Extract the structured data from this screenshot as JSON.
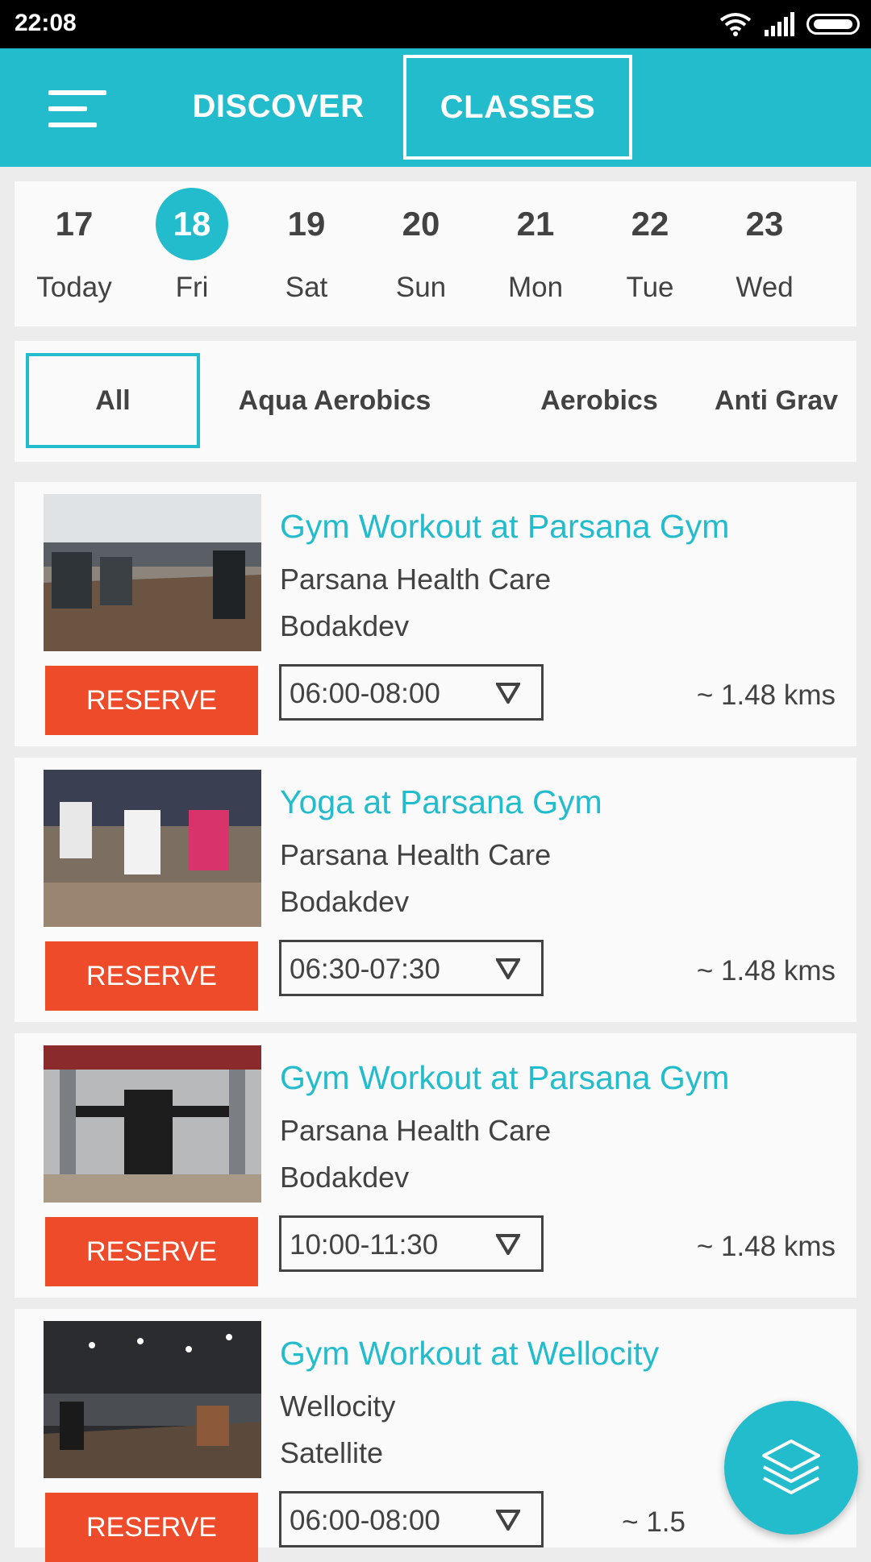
{
  "status_bar": {
    "time": "22:08"
  },
  "app_bar": {
    "tabs": [
      {
        "label": "DISCOVER",
        "selected": false
      },
      {
        "label": "CLASSES",
        "selected": true
      }
    ]
  },
  "dates": [
    {
      "num": "17",
      "label": "Today",
      "selected": false
    },
    {
      "num": "18",
      "label": "Fri",
      "selected": true
    },
    {
      "num": "19",
      "label": "Sat",
      "selected": false
    },
    {
      "num": "20",
      "label": "Sun",
      "selected": false
    },
    {
      "num": "21",
      "label": "Mon",
      "selected": false
    },
    {
      "num": "22",
      "label": "Tue",
      "selected": false
    },
    {
      "num": "23",
      "label": "Wed",
      "selected": false
    }
  ],
  "categories": [
    {
      "label": "All",
      "selected": true
    },
    {
      "label": "Aqua Aerobics",
      "selected": false
    },
    {
      "label": "Aerobics",
      "selected": false
    },
    {
      "label": "Anti Grav",
      "selected": false
    }
  ],
  "classes": [
    {
      "title": "Gym Workout at Parsana Gym",
      "venue": "Parsana Health Care",
      "area": "Bodakdev",
      "button": "RESERVE",
      "time": "06:00-08:00",
      "distance": "~ 1.48 kms"
    },
    {
      "title": "Yoga at Parsana Gym",
      "venue": "Parsana Health Care",
      "area": "Bodakdev",
      "button": "RESERVE",
      "time": "06:30-07:30",
      "distance": "~ 1.48 kms"
    },
    {
      "title": "Gym Workout at Parsana Gym",
      "venue": "Parsana Health Care",
      "area": "Bodakdev",
      "button": "RESERVE",
      "time": "10:00-11:30",
      "distance": "~ 1.48 kms"
    },
    {
      "title": "Gym Workout at Wellocity",
      "venue": "Wellocity",
      "area": "Satellite",
      "button": "RESERVE",
      "time": "06:00-08:00",
      "distance": "~ 1.5"
    }
  ],
  "colors": {
    "primary": "#23bccc",
    "accent": "#ee4b2b",
    "text": "#424242"
  },
  "icons": {
    "menu": "hamburger-icon",
    "fab": "layers-icon",
    "dropdown": "triangle-down-icon"
  }
}
